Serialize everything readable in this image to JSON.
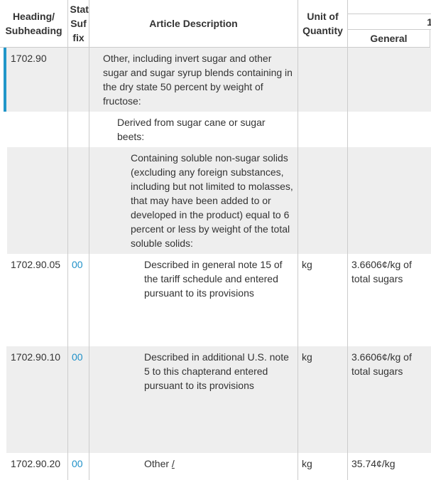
{
  "header": {
    "heading": "Heading/ Subheading",
    "stat_suffix": "Stat Suf fix",
    "description": "Article Description",
    "unit": "Unit of Quantity",
    "rates_group": "1",
    "general": "General"
  },
  "colors": {
    "accent": "#2196c9",
    "stat_link": "#1e90c8",
    "row_shade": "#eeeeee"
  },
  "rows": [
    {
      "heading": "1702.90",
      "suffix": "",
      "description": "Other, including invert sugar and other sugar and sugar syrup blends containing in the dry state 50 percent by weight of fructose:",
      "unit": "",
      "general": ""
    },
    {
      "heading": "",
      "suffix": "",
      "description": "Derived from sugar cane or sugar beets:",
      "unit": "",
      "general": ""
    },
    {
      "heading": "",
      "suffix": "",
      "description": "Containing soluble non-sugar solids (excluding any foreign substances, including but not limited to molasses, that may have been added to or developed in the product) equal to 6 percent or less by weight of the total soluble solids:",
      "unit": "",
      "general": ""
    },
    {
      "heading": "1702.90.05",
      "suffix": "00",
      "description": "Described in general note 15 of the tariff schedule and entered pursuant to its provisions",
      "unit": "kg",
      "general": "3.6606¢/kg of total sugars"
    },
    {
      "heading": "1702.90.10",
      "suffix": "00",
      "description": "Described in additional U.S. note 5 to this chapterand entered pursuant to its provisions",
      "unit": "kg",
      "general": "3.6606¢/kg of total sugars"
    },
    {
      "heading": "1702.90.20",
      "suffix": "00",
      "description": "Other",
      "footnote": "/",
      "unit": "kg",
      "general": "35.74¢/kg"
    }
  ]
}
